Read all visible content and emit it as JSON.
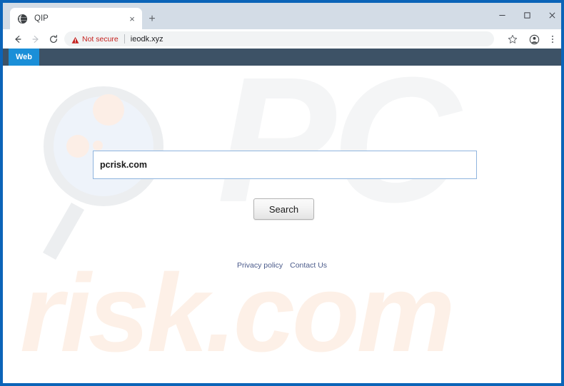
{
  "browser": {
    "tab": {
      "title": "QIP",
      "favicon": "globe-icon",
      "close_label": "×"
    },
    "new_tab_label": "+",
    "window_controls": {
      "minimize": "–",
      "maximize": "□",
      "close": "×"
    },
    "toolbar": {
      "back_label": "←",
      "forward_label": "→",
      "reload_label": "↻",
      "security_status": "Not secure",
      "url": "ieodk.xyz",
      "bookmark_label": "☆",
      "menu_label": "⋮"
    }
  },
  "site": {
    "navbar": {
      "tabs": [
        {
          "label": "Web",
          "active": true
        }
      ],
      "background_color": "#3d5266",
      "active_tab_color": "#1a8fd8"
    },
    "search": {
      "query_value": "pcrisk.com",
      "placeholder": "",
      "button_label": "Search"
    },
    "footer": {
      "links": [
        {
          "label": "Privacy policy"
        },
        {
          "label": "Contact Us"
        }
      ],
      "link_color": "#4a5a8a"
    },
    "watermark": {
      "brand_top": "PC",
      "brand_bottom": "risk.com",
      "magnifier_ring_color": "#eceef0",
      "magnifier_lens_color": "#eef3fa",
      "dot_color": "#fceee6",
      "top_text_color": "#f4f5f6",
      "bottom_text_color": "#fdf0e7"
    }
  },
  "window": {
    "frame_color": "#0b64b8"
  }
}
